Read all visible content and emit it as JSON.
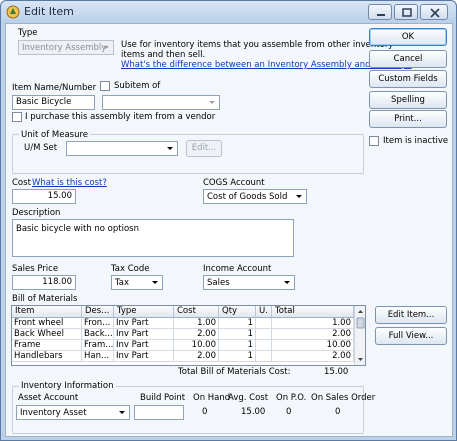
{
  "window": {
    "title": "Edit Item"
  },
  "type_section": {
    "label": "Type",
    "selected": "Inventory Assembly",
    "description": "Use for inventory items that you assemble from other inventory items and then sell.",
    "description_line1": "Use for inventory items that you assemble from other inventory",
    "description_line2": "items and then sell.",
    "help_link": "What's the difference between an Inventory Assembly and a Group?"
  },
  "item_name": {
    "label": "Item Name/Number",
    "value": "Basic Bicycle"
  },
  "subitem": {
    "label": "Subitem of",
    "checked": false,
    "value": ""
  },
  "purchase_checkbox": {
    "label": "I purchase this assembly item from a vendor",
    "checked": false
  },
  "unit_of_measure": {
    "group_label": "Unit of Measure",
    "set_label": "U/M Set",
    "value": "",
    "edit_label": "Edit..."
  },
  "cost": {
    "label": "Cost",
    "link": "What is this cost?",
    "value": "15.00"
  },
  "cogs": {
    "label": "COGS Account",
    "value": "Cost of Goods Sold"
  },
  "description": {
    "label": "Description",
    "value": "Basic bicycle with no optiosn"
  },
  "sales_price": {
    "label": "Sales Price",
    "value": "118.00"
  },
  "tax_code": {
    "label": "Tax Code",
    "value": "Tax"
  },
  "income_account": {
    "label": "Income Account",
    "value": "Sales"
  },
  "bom": {
    "label": "Bill of Materials",
    "columns": [
      "Item",
      "Des...",
      "Type",
      "Cost",
      "Qty",
      "U.",
      "Total"
    ],
    "rows": [
      {
        "item": "Front wheel",
        "desc": "Fron...",
        "type": "Inv Part",
        "cost": "1.00",
        "qty": "1",
        "um": "",
        "total": "1.00"
      },
      {
        "item": "Back Wheel",
        "desc": "Back...",
        "type": "Inv Part",
        "cost": "2.00",
        "qty": "1",
        "um": "",
        "total": "2.00"
      },
      {
        "item": "Frame",
        "desc": "Fram...",
        "type": "Inv Part",
        "cost": "10.00",
        "qty": "1",
        "um": "",
        "total": "10.00"
      },
      {
        "item": "Handlebars",
        "desc": "Han...",
        "type": "Inv Part",
        "cost": "2.00",
        "qty": "1",
        "um": "",
        "total": "2.00"
      }
    ],
    "total_label": "Total Bill of Materials Cost:",
    "total_value": "15.00"
  },
  "inventory_info": {
    "group_label": "Inventory Information",
    "asset_account_label": "Asset Account",
    "asset_account_value": "Inventory Asset",
    "build_point_label": "Build Point",
    "build_point_value": "",
    "on_hand_label": "On Hand",
    "on_hand_value": "0",
    "avg_cost_label": "Avg. Cost",
    "avg_cost_value": "15.00",
    "on_po_label": "On P.O.",
    "on_po_value": "0",
    "on_sales_order_label": "On Sales Order",
    "on_sales_order_value": "0"
  },
  "buttons": {
    "ok": "OK",
    "cancel": "Cancel",
    "custom_fields": "Custom Fields",
    "spelling": "Spelling",
    "print": "Print...",
    "item_inactive": "Item is inactive",
    "edit_item": "Edit Item...",
    "full_view": "Full View..."
  },
  "colors": {
    "window_frame": "#bcd1e8",
    "client_bg": "#f3f6fa",
    "link": "#1036c6",
    "ok_border": "#3d7bc3"
  }
}
